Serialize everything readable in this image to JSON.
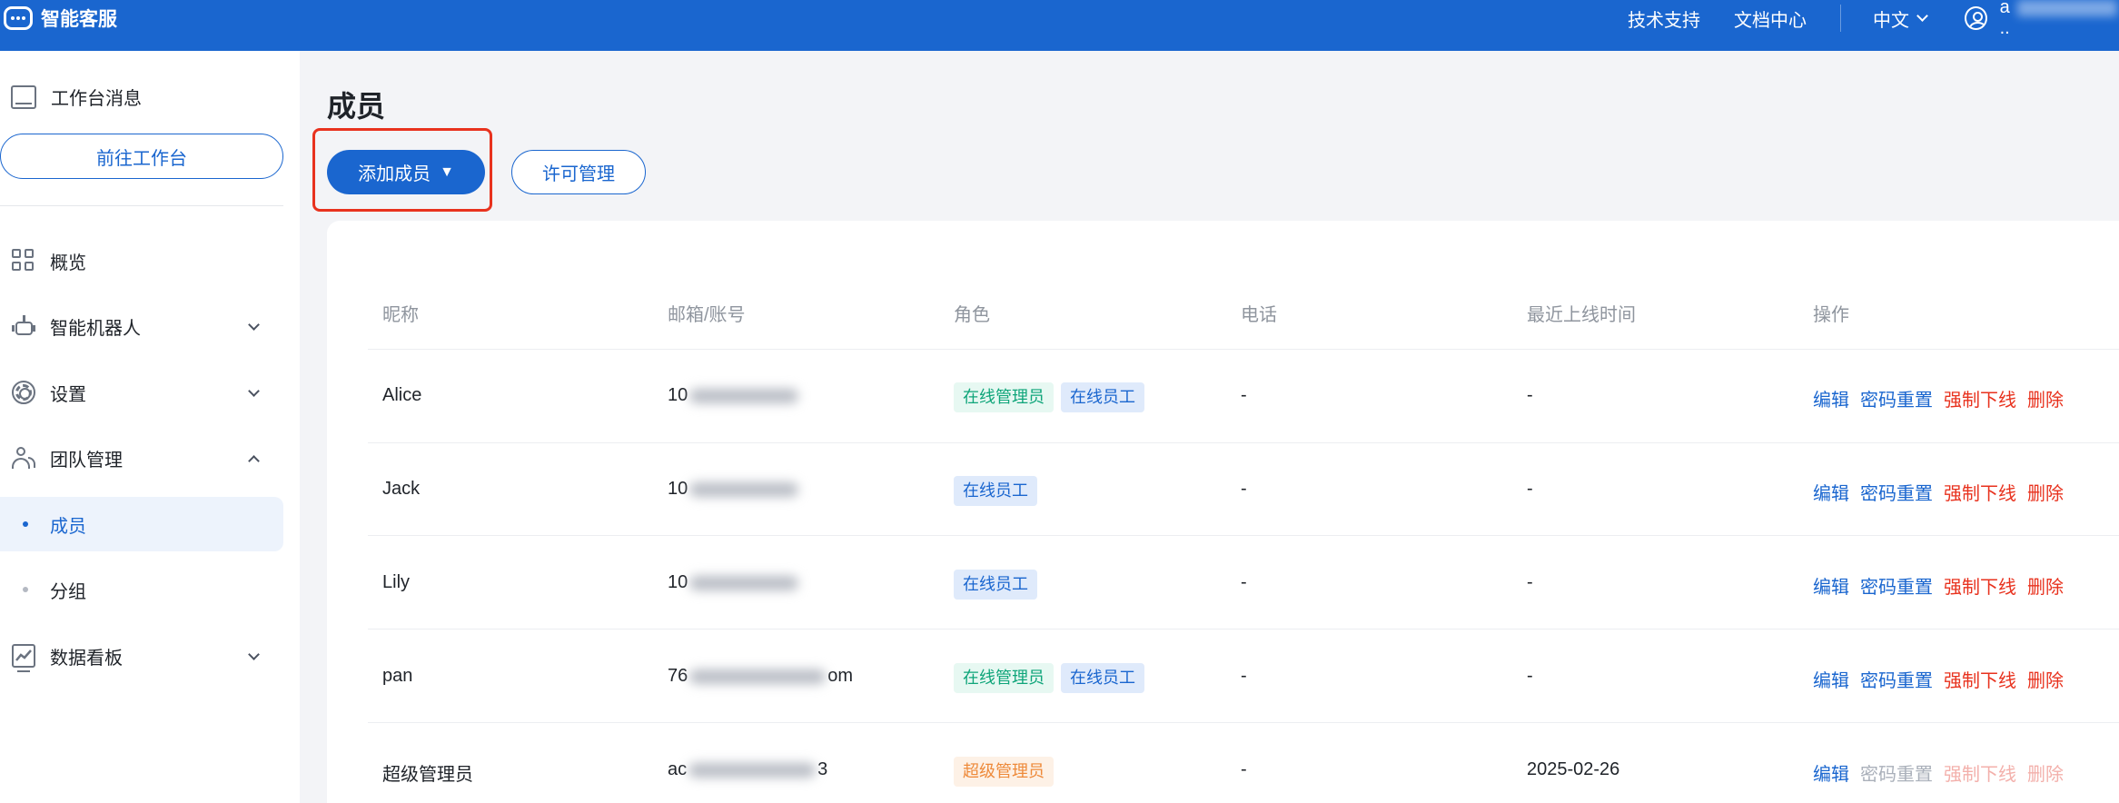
{
  "app": {
    "title": "智能客服",
    "top_links": [
      "技术支持",
      "文档中心"
    ],
    "language": "中文",
    "user_initial": "a",
    "user_suffix": ".."
  },
  "sidebar": {
    "workbench_message": "工作台消息",
    "goto_workbench": "前往工作台",
    "items": [
      {
        "label": "概览",
        "icon": "grid-icon"
      },
      {
        "label": "智能机器人",
        "icon": "robot-icon"
      },
      {
        "label": "设置",
        "icon": "gear-icon"
      },
      {
        "label": "团队管理",
        "icon": "team-icon"
      },
      {
        "label": "数据看板",
        "icon": "chart-icon"
      }
    ],
    "sub_items": [
      {
        "label": "成员",
        "active": true
      },
      {
        "label": "分组",
        "active": false
      }
    ]
  },
  "main": {
    "page_title": "成员",
    "add_member": "添加成员",
    "add_member_caret": "▼",
    "license": "许可管理",
    "table": {
      "headers": [
        "昵称",
        "邮箱/账号",
        "角色",
        "电话",
        "最近上线时间",
        "操作"
      ],
      "rows": [
        {
          "nickname": "Alice",
          "email_prefix": "10",
          "email_suffix": "",
          "roles": [
            "在线管理员",
            "在线员工"
          ],
          "phone": "-",
          "last_online": "-"
        },
        {
          "nickname": "Jack",
          "email_prefix": "10",
          "email_suffix": "",
          "roles": [
            "在线员工"
          ],
          "phone": "-",
          "last_online": "-"
        },
        {
          "nickname": "Lily",
          "email_prefix": "10",
          "email_suffix": "",
          "roles": [
            "在线员工"
          ],
          "phone": "-",
          "last_online": "-"
        },
        {
          "nickname": "pan",
          "email_prefix": "76",
          "email_suffix": "om",
          "roles": [
            "在线管理员",
            "在线员工"
          ],
          "phone": "-",
          "last_online": "-"
        },
        {
          "nickname": "超级管理员",
          "email_prefix": "ac",
          "email_suffix": "3",
          "roles": [
            "超级管理员"
          ],
          "phone": "-",
          "last_online": "2025-02-26"
        }
      ],
      "actions": [
        "编辑",
        "密码重置",
        "强制下线",
        "删除"
      ]
    }
  },
  "colors": {
    "primary": "#1a66cf",
    "danger": "#e8321e",
    "highlight": "#e8321e"
  }
}
